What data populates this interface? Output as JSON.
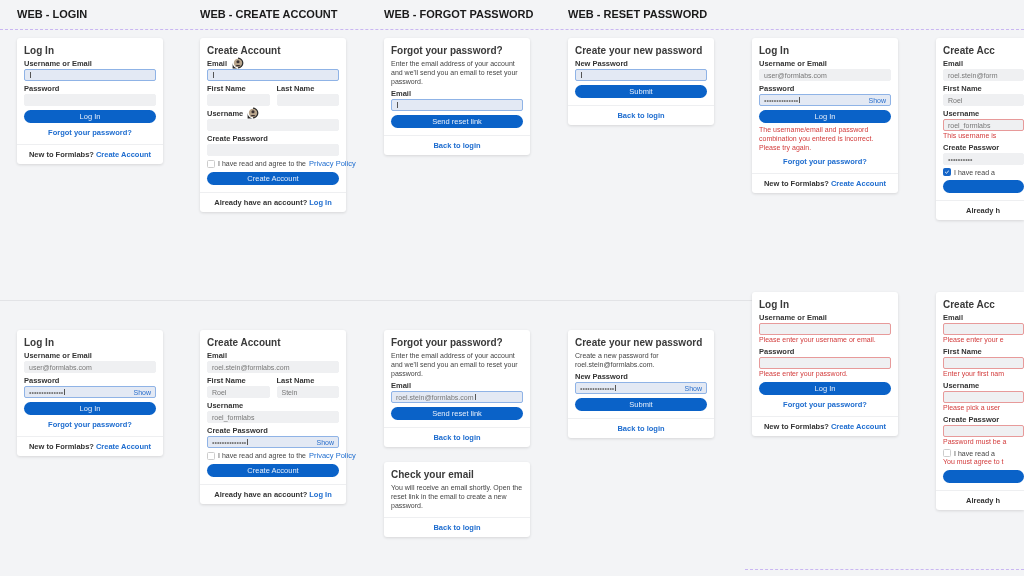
{
  "sections": [
    {
      "title": "WEB - LOGIN"
    },
    {
      "title": "WEB - CREATE ACCOUNT"
    },
    {
      "title": "WEB - FORGOT PASSWORD"
    },
    {
      "title": "WEB - RESET PASSWORD"
    }
  ],
  "cards": [
    {
      "title": "Log In",
      "rows": [
        {
          "kind": "field",
          "label": "Username or Email",
          "focused": true,
          "invalid": false
        },
        {
          "kind": "field",
          "label": "Password",
          "focused": false,
          "invalid": false
        },
        {
          "kind": "button",
          "label": "Log In"
        },
        {
          "kind": "link",
          "label": "Forgot your password?"
        }
      ],
      "footer": {
        "text": "New to Formlabs?",
        "link": "Create Account"
      }
    },
    {
      "title": "Create Account",
      "rows": [
        {
          "kind": "field",
          "label": "Email",
          "focused": true,
          "invalid": false
        },
        {
          "kind": "pair",
          "fields": [
            {
              "label": "First Name",
              "focused": false,
              "invalid": false
            },
            {
              "label": "Last Name",
              "focused": false,
              "invalid": false
            }
          ]
        },
        {
          "kind": "field",
          "label": "Username",
          "focused": false,
          "invalid": false
        },
        {
          "kind": "field",
          "label": "Create Password",
          "focused": false,
          "invalid": false
        },
        {
          "kind": "checkbox",
          "checked": false,
          "text": "I have read and agree to the",
          "link": "Privacy Policy"
        },
        {
          "kind": "button",
          "label": "Create Account"
        }
      ],
      "footer": {
        "text": "Already have an account?",
        "link": "Log In"
      }
    },
    {
      "title": "Forgot your password?",
      "text": "Enter the email address of your account and we'll send you an email to reset your password.",
      "rows": [
        {
          "kind": "field",
          "label": "Email",
          "focused": true,
          "invalid": false
        },
        {
          "kind": "button",
          "label": "Send reset link"
        }
      ],
      "footer": {
        "link": "Back to login"
      }
    },
    {
      "title": "Create your new password",
      "rows": [
        {
          "kind": "field",
          "label": "New Password",
          "focused": true,
          "invalid": false
        },
        {
          "kind": "button",
          "label": "Submit"
        }
      ],
      "footer": {
        "link": "Back to login"
      }
    },
    {
      "title": "Log In",
      "rows": [
        {
          "kind": "field",
          "label": "Username or Email",
          "value": "user@formlabs.com",
          "focused": false,
          "invalid": false
        },
        {
          "kind": "field",
          "label": "Password",
          "value": "••••••••••••••",
          "toggle": "Show",
          "focused": true,
          "invalid": false
        },
        {
          "kind": "button",
          "label": "Log In"
        },
        {
          "kind": "error",
          "text": "The username/email and password combination you entered is incorrect. Please try again."
        },
        {
          "kind": "link",
          "label": "Forgot your password?"
        }
      ],
      "footer": {
        "text": "New to Formlabs?",
        "link": "Create Account"
      }
    },
    {
      "title": "Create Acc",
      "rows": [
        {
          "kind": "field",
          "label": "Email",
          "value": "roel.stein@form",
          "focused": false,
          "invalid": false
        },
        {
          "kind": "field",
          "label": "First Name",
          "value": "Roel",
          "focused": false,
          "invalid": false
        },
        {
          "kind": "field",
          "label": "Username",
          "value": "roel_formlabs",
          "focused": false,
          "invalid": true,
          "message": "This username is"
        },
        {
          "kind": "field",
          "label": "Create Passwor",
          "value": "••••••••••",
          "focused": false,
          "invalid": false
        },
        {
          "kind": "checkbox",
          "checked": true,
          "text": "I have read a"
        },
        {
          "kind": "button"
        }
      ],
      "footer": {
        "text": "Already h"
      }
    },
    {
      "title": "Log In",
      "rows": [
        {
          "kind": "field",
          "label": "Username or Email",
          "value": "user@formlabs.com",
          "focused": false,
          "invalid": false
        },
        {
          "kind": "field",
          "label": "Password",
          "value": "••••••••••••••",
          "toggle": "Show",
          "focused": true,
          "invalid": false
        },
        {
          "kind": "button",
          "label": "Log In"
        },
        {
          "kind": "link",
          "label": "Forgot your password?"
        }
      ],
      "footer": {
        "text": "New to Formlabs?",
        "link": "Create Account"
      }
    },
    {
      "title": "Create Account",
      "rows": [
        {
          "kind": "field",
          "label": "Email",
          "value": "roel.stein@formlabs.com",
          "focused": false,
          "invalid": false
        },
        {
          "kind": "pair",
          "fields": [
            {
              "label": "First Name",
              "value": "Roel",
              "focused": false,
              "invalid": false
            },
            {
              "label": "Last Name",
              "value": "Stein",
              "focused": false,
              "invalid": false
            }
          ]
        },
        {
          "kind": "field",
          "label": "Username",
          "value": "roel_formlabs",
          "focused": false,
          "invalid": false
        },
        {
          "kind": "field",
          "label": "Create Password",
          "value": "••••••••••••••",
          "toggle": "Show",
          "focused": true,
          "invalid": false
        },
        {
          "kind": "checkbox",
          "checked": false,
          "text": "I have read and agree to the",
          "link": "Privacy Policy"
        },
        {
          "kind": "button",
          "label": "Create Account"
        }
      ],
      "footer": {
        "text": "Already have an account?",
        "link": "Log In"
      }
    },
    {
      "title": "Forgot your password?",
      "text": "Enter the email address of your account and we'll send you an email to reset your password.",
      "rows": [
        {
          "kind": "field",
          "label": "Email",
          "value": "roel.stein@formlabs.com",
          "focused": true,
          "invalid": false
        },
        {
          "kind": "button",
          "label": "Send reset link"
        }
      ],
      "footer": {
        "link": "Back to login"
      }
    },
    {
      "title": "Check your email",
      "text": "You will receive an email shortly. Open the reset link in the email to create a new password.",
      "footer": {
        "link": "Back to login"
      }
    },
    {
      "title": "Create your new password",
      "text": "Create a new password for roel.stein@formlabs.com.",
      "rows": [
        {
          "kind": "field",
          "label": "New Password",
          "value": "••••••••••••••",
          "toggle": "Show",
          "focused": true,
          "invalid": false
        },
        {
          "kind": "button",
          "label": "Submit"
        }
      ],
      "footer": {
        "link": "Back to login"
      }
    },
    {
      "title": "Log In",
      "rows": [
        {
          "kind": "field",
          "label": "Username or Email",
          "focused": false,
          "invalid": true,
          "message": "Please enter your username or email."
        },
        {
          "kind": "field",
          "label": "Password",
          "focused": false,
          "invalid": true,
          "message": "Please enter your password."
        },
        {
          "kind": "button",
          "label": "Log In"
        },
        {
          "kind": "link",
          "label": "Forgot your password?"
        }
      ],
      "footer": {
        "text": "New to Formlabs?",
        "link": "Create Account"
      }
    },
    {
      "title": "Create Acc",
      "rows": [
        {
          "kind": "field",
          "label": "Email",
          "focused": false,
          "invalid": true,
          "message": "Please enter your e"
        },
        {
          "kind": "field",
          "label": "First Name",
          "focused": false,
          "invalid": true,
          "message": "Enter your first nam"
        },
        {
          "kind": "field",
          "label": "Username",
          "focused": false,
          "invalid": true,
          "message": "Please pick a user"
        },
        {
          "kind": "field",
          "label": "Create Passwor",
          "focused": false,
          "invalid": true,
          "message": "Password must be a"
        },
        {
          "kind": "checkbox",
          "checked": false,
          "text": "I have read a",
          "message": "You must agree to t"
        },
        {
          "kind": "button"
        }
      ],
      "footer": {
        "text": "Already h"
      }
    }
  ]
}
